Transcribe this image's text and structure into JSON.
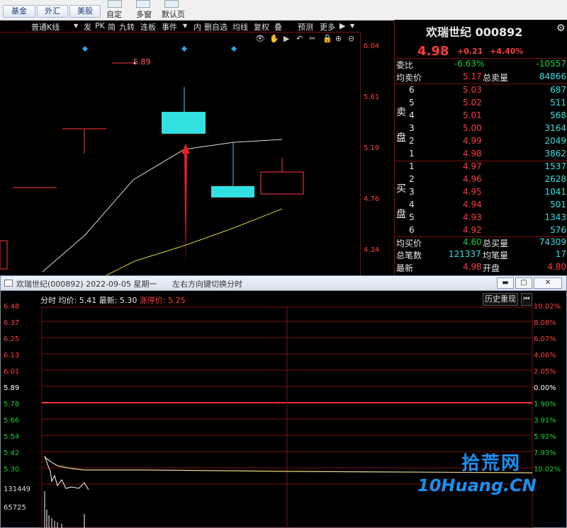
{
  "toolbar": {
    "buttons": [
      "基金",
      "外汇",
      "美股"
    ],
    "labels": [
      "自定",
      "多窗",
      "默认页"
    ]
  },
  "kline": {
    "tools": [
      "普通K线",
      "▼",
      "发",
      "PK",
      "简",
      "九转",
      "连板",
      "事件",
      "▼",
      "内",
      "删自选",
      "均线",
      "复权",
      "叠",
      "预测",
      "更多",
      "▶",
      "▼"
    ],
    "icons": [
      "👁",
      "✋",
      "▶",
      "↶",
      "✂",
      "🔒",
      "⊕",
      "⊖"
    ],
    "price_marker": "5.89",
    "axis": [
      "6.04",
      "5.61",
      "5.19",
      "4.76",
      "4.34"
    ]
  },
  "quote": {
    "title": "欢瑞世纪 000892",
    "price": "4.98",
    "change": "+0.21",
    "change_pct": "+4.40%",
    "weibi_label": "委比",
    "weibi_pct": "-6.63%",
    "weibi_val": "-10557",
    "avg_sell_label": "均卖价",
    "avg_sell": "5.17",
    "total_sell_label": "总卖量",
    "total_sell": "84866",
    "sell_label": [
      "卖",
      "盘"
    ],
    "sells": [
      {
        "lvl": "6",
        "price": "5.03",
        "vol": "687"
      },
      {
        "lvl": "5",
        "price": "5.02",
        "vol": "511"
      },
      {
        "lvl": "4",
        "price": "5.01",
        "vol": "568"
      },
      {
        "lvl": "3",
        "price": "5.00",
        "vol": "3164"
      },
      {
        "lvl": "2",
        "price": "4.99",
        "vol": "2049"
      },
      {
        "lvl": "1",
        "price": "4.98",
        "vol": "3862"
      }
    ],
    "buy_label": [
      "买",
      "盘"
    ],
    "buys": [
      {
        "lvl": "1",
        "price": "4.97",
        "vol": "1537"
      },
      {
        "lvl": "2",
        "price": "4.96",
        "vol": "2628"
      },
      {
        "lvl": "3",
        "price": "4.95",
        "vol": "1041"
      },
      {
        "lvl": "4",
        "price": "4.94",
        "vol": "501"
      },
      {
        "lvl": "5",
        "price": "4.93",
        "vol": "1343"
      },
      {
        "lvl": "6",
        "price": "4.92",
        "vol": "576"
      }
    ],
    "avg_buy_label": "均买价",
    "avg_buy": "4.60",
    "total_buy_label": "总买量",
    "total_buy": "74309",
    "trades_label": "总笔数",
    "trades": "121337",
    "avg_lot_label": "均笔量",
    "avg_lot": "17",
    "latest_label": "最新",
    "latest": "4.98",
    "open_label": "开盘",
    "open": "4.80"
  },
  "window": {
    "title": "欢瑞世纪(000892) 2022-09-05 星期一",
    "hint": "左右方向键切换分时",
    "info_label": "分时 均价:",
    "info_avg": "5.41",
    "info_latest_label": "最新:",
    "info_latest": "5.30",
    "info_limit_label": "涨停价:",
    "info_limit": "5.25",
    "history_btn": "历史重现",
    "left_ticks": [
      "6.48",
      "6.37",
      "6.25",
      "6.13",
      "6.01",
      "5.89",
      "5.78",
      "5.66",
      "5.54",
      "5.42",
      "5.30"
    ],
    "right_ticks": [
      "10.02%",
      "8.08%",
      "6.07%",
      "4.06%",
      "2.05%",
      "0.00%",
      "1.90%",
      "3.91%",
      "5.92%",
      "7.93%",
      "10.02%"
    ],
    "vol_ticks": [
      "131449",
      "65725"
    ]
  },
  "watermark": {
    "cn": "拾荒网",
    "en": "10Huang.CN"
  },
  "colors": {
    "up": "#ff3b3b",
    "down": "#19d13a",
    "cyan": "#33e0e0",
    "grid": "#7a1010"
  }
}
